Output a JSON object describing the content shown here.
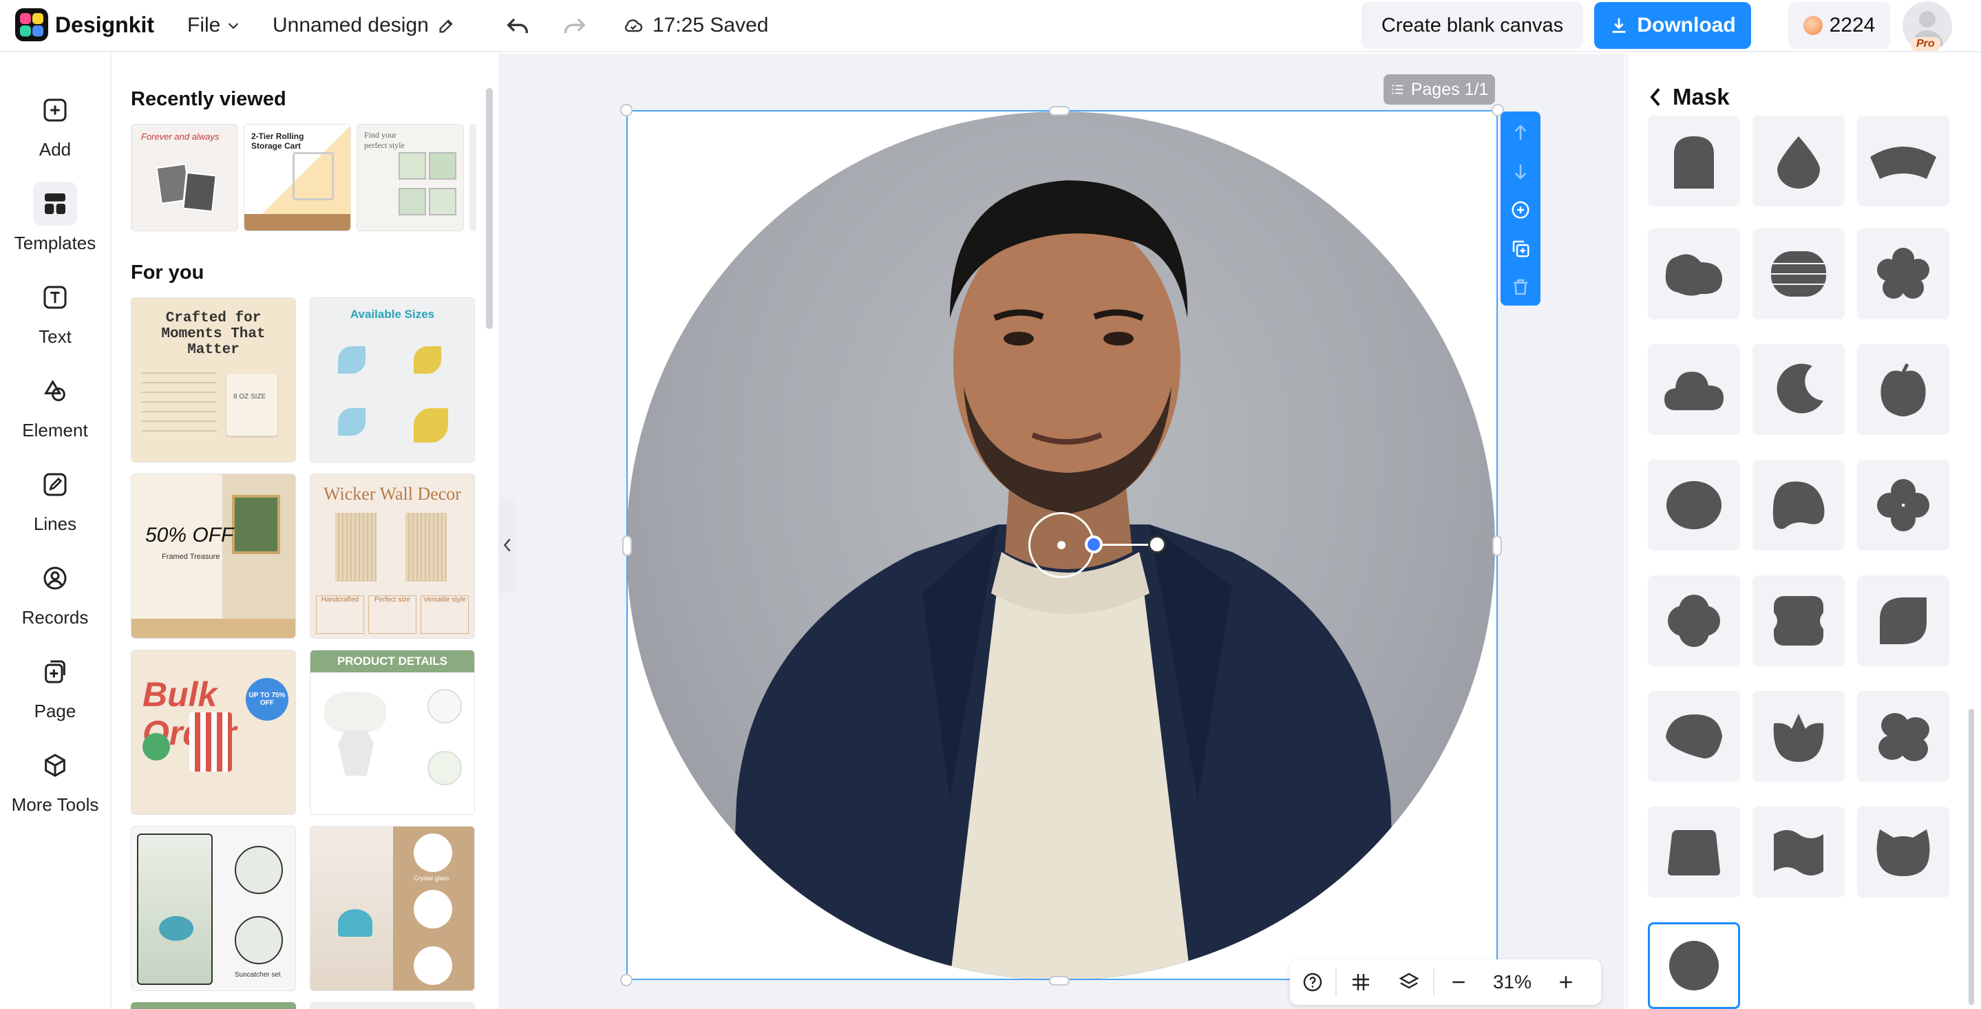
{
  "app": {
    "brand": "Designkit"
  },
  "header": {
    "file_label": "File",
    "design_name": "Unnamed design",
    "save_status": "17:25 Saved",
    "create_blank_label": "Create blank canvas",
    "download_label": "Download",
    "credits": "2224",
    "pro_badge": "Pro"
  },
  "rail": {
    "items": [
      {
        "label": "Add",
        "icon": "plus-square-icon"
      },
      {
        "label": "Templates",
        "icon": "templates-grid-icon",
        "active": true
      },
      {
        "label": "Text",
        "icon": "text-t-icon"
      },
      {
        "label": "Element",
        "icon": "shapes-icon"
      },
      {
        "label": "Lines",
        "icon": "pen-icon"
      },
      {
        "label": "Records",
        "icon": "user-circle-icon"
      },
      {
        "label": "Page",
        "icon": "page-plus-icon"
      },
      {
        "label": "More Tools",
        "icon": "cube-icon"
      }
    ]
  },
  "panel": {
    "recent_heading": "Recently viewed",
    "foryou_heading": "For you",
    "recent": [
      {
        "caption": "Forever and always"
      },
      {
        "caption": "2-Tier Rolling Storage Cart"
      },
      {
        "caption": "Find your perfect style"
      }
    ],
    "templates": [
      {
        "title": "Crafted for Moments That Matter",
        "badge": "8 OZ SIZE"
      },
      {
        "title": "Available Sizes"
      },
      {
        "title": "50% OFF",
        "subtitle": "Framed Treasure"
      },
      {
        "title": "Wicker Wall Decor",
        "chips": [
          "Handcrafted",
          "Perfect size",
          "Versatile style"
        ]
      },
      {
        "title": "Bulk Order",
        "burst": "UP TO 75% OFF"
      },
      {
        "title": "PRODUCT DETAILS"
      },
      {
        "title": "Suncatcher set"
      },
      {
        "title": "Crystal glass"
      }
    ]
  },
  "canvas": {
    "pages_label": "Pages 1/1",
    "zoom": "31%"
  },
  "mask_panel": {
    "title": "Mask",
    "shapes": [
      "arch",
      "drop",
      "fan",
      "cloud-blob",
      "stack",
      "flower",
      "cloud",
      "moon",
      "apple",
      "oval",
      "blob",
      "clover",
      "rounded-clover",
      "rounded-square",
      "leaf",
      "shell",
      "tulip",
      "petal-flower",
      "trapezoid",
      "flag",
      "cat",
      "circle"
    ],
    "selected": "circle"
  },
  "colors": {
    "accent": "#1a8cff",
    "selection": "#4aa3ff"
  }
}
